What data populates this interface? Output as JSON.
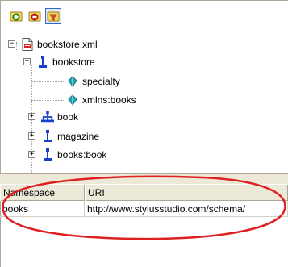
{
  "toolbar": {
    "buttons": [
      {
        "icon": "add-green-icon",
        "pressed": false
      },
      {
        "icon": "folder-remove-icon",
        "pressed": false
      },
      {
        "icon": "filter-icon",
        "pressed": true
      }
    ]
  },
  "tree": {
    "root": {
      "label": "bookstore.xml",
      "icon": "xml-file-icon",
      "expanded": true
    },
    "bookstore": {
      "label": "bookstore",
      "icon": "element-icon",
      "expanded": true
    },
    "children": [
      {
        "label": "specialty",
        "icon": "attribute-icon",
        "expander": "none"
      },
      {
        "label": "xmlns:books",
        "icon": "attribute-icon",
        "expander": "none"
      },
      {
        "label": "book",
        "icon": "element-group-icon",
        "expander": "collapsed"
      },
      {
        "label": "magazine",
        "icon": "element-icon",
        "expander": "collapsed"
      },
      {
        "label": "books:book",
        "icon": "element-icon",
        "expander": "collapsed"
      }
    ]
  },
  "grid": {
    "headers": [
      "Namespace",
      "URI"
    ],
    "rows": [
      [
        "books",
        "http://www.stylusstudio.com/schema/"
      ]
    ]
  },
  "colors": {
    "annotation_ellipse": "#e02020",
    "element_icon_blue": "#1a3fd0",
    "attribute_icon_teal": "#1a8a9a",
    "header_bg": "#ece9d8"
  }
}
